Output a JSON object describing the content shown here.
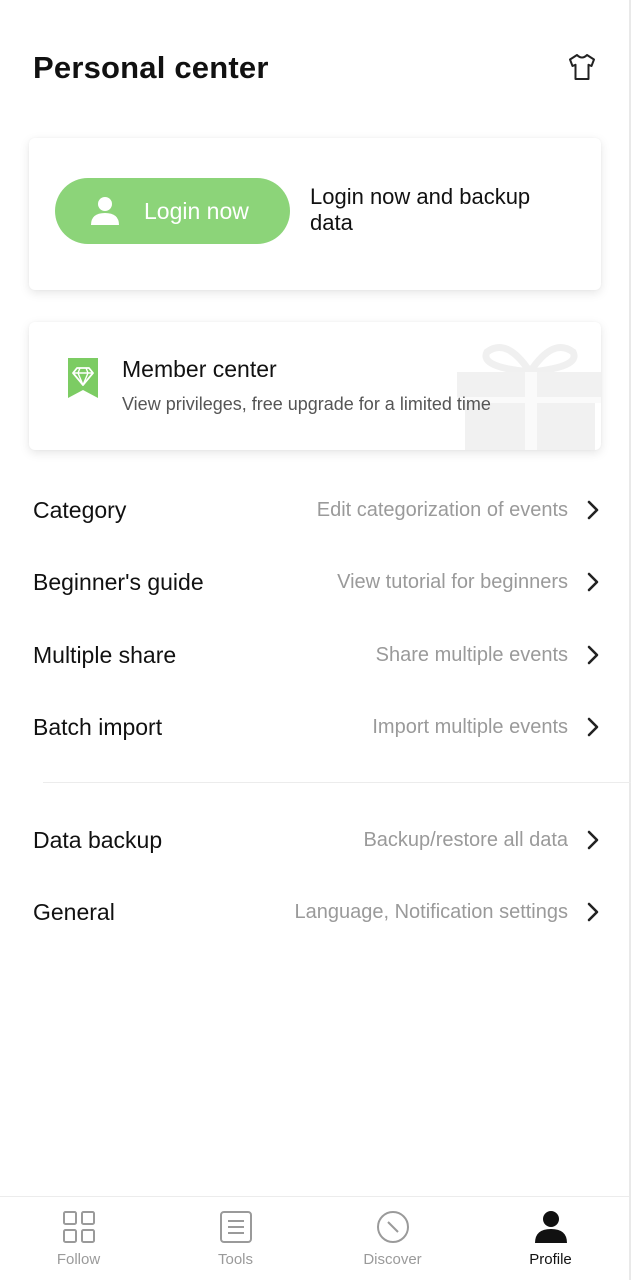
{
  "header": {
    "title": "Personal center",
    "skin_icon": "tshirt-icon"
  },
  "login_card": {
    "button_label": "Login now",
    "description": "Login now and backup data",
    "accent": "#8cd479"
  },
  "member_card": {
    "title": "Member center",
    "subtitle": "View privileges, free upgrade for a limited time"
  },
  "menu_group_1": [
    {
      "title": "Category",
      "description": "Edit categorization of events"
    },
    {
      "title": "Beginner's guide",
      "description": "View tutorial for beginners"
    },
    {
      "title": "Multiple share",
      "description": "Share multiple events"
    },
    {
      "title": "Batch import",
      "description": "Import multiple events"
    }
  ],
  "menu_group_2": [
    {
      "title": "Data backup",
      "description": "Backup/restore all data"
    },
    {
      "title": "General",
      "description": "Language, Notification settings"
    }
  ],
  "tabbar": {
    "tabs": [
      {
        "label": "Follow",
        "icon": "grid-icon"
      },
      {
        "label": "Tools",
        "icon": "list-icon"
      },
      {
        "label": "Discover",
        "icon": "compass-icon"
      },
      {
        "label": "Profile",
        "icon": "person-icon"
      }
    ],
    "active": "Profile"
  }
}
